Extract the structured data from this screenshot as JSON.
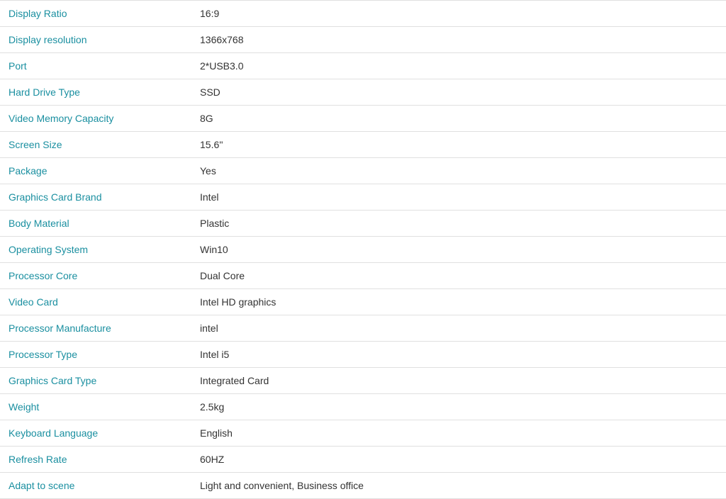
{
  "specs": [
    {
      "label": "Display Ratio",
      "value": "16:9"
    },
    {
      "label": "Display resolution",
      "value": "1366x768"
    },
    {
      "label": "Port",
      "value": "2*USB3.0"
    },
    {
      "label": "Hard Drive Type",
      "value": "SSD"
    },
    {
      "label": "Video Memory Capacity",
      "value": "8G"
    },
    {
      "label": "Screen Size",
      "value": "15.6''"
    },
    {
      "label": "Package",
      "value": "Yes"
    },
    {
      "label": "Graphics Card Brand",
      "value": "Intel"
    },
    {
      "label": "Body Material",
      "value": "Plastic"
    },
    {
      "label": "Operating System",
      "value": "Win10"
    },
    {
      "label": "Processor Core",
      "value": "Dual Core"
    },
    {
      "label": "Video Card",
      "value": "Intel HD graphics"
    },
    {
      "label": "Processor Manufacture",
      "value": "intel"
    },
    {
      "label": "Processor Type",
      "value": "Intel i5"
    },
    {
      "label": "Graphics Card Type",
      "value": "Integrated Card"
    },
    {
      "label": "Weight",
      "value": "2.5kg"
    },
    {
      "label": "Keyboard Language",
      "value": "English"
    },
    {
      "label": "Refresh Rate",
      "value": "60HZ"
    },
    {
      "label": "Adapt to scene",
      "value": "Light and convenient, Business office"
    }
  ]
}
